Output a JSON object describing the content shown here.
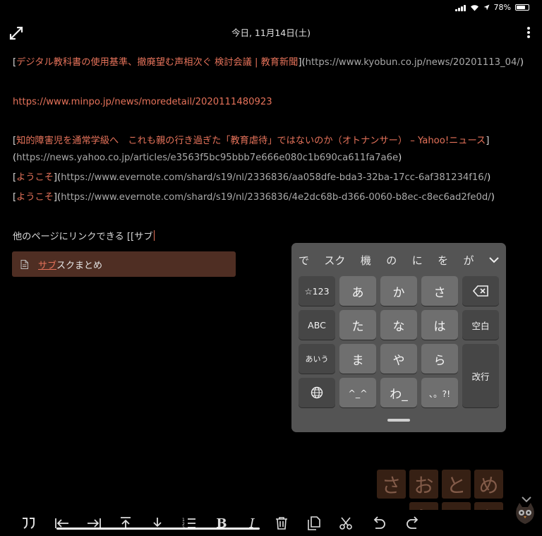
{
  "status_bar": {
    "battery": "78%",
    "battery_level": 0.78
  },
  "header": {
    "date": "今日, 11月14日(土)",
    "expand_icon": "expand-icon",
    "more_icon": "more-vertical-icon"
  },
  "note": {
    "l1": {
      "open": "[",
      "title": "デジタル教科書の使用基準、撤廃望む声相次ぐ 検討会議 | 教育新聞",
      "mid": "](",
      "url": "https://www.kyobun.co.jp/news/20201113_04/",
      "close": ")"
    },
    "l2": {
      "url": "https://www.minpo.jp/news/moredetail/2020111480923"
    },
    "l3": {
      "open": "[",
      "title": "知的障害児を通常学級へ　これも親の行き過ぎた「教育虐待」ではないのか（オトナンサー） – Yahoo!ニュース",
      "close": "]"
    },
    "l4": {
      "open": "(",
      "url": "https://news.yahoo.co.jp/articles/e3563f5bc95bbb7e666e080c1b690ca611fa7a6e",
      "close": ")"
    },
    "l5": {
      "open": "[",
      "title": "ようこそ",
      "mid": "](",
      "url": "https://www.evernote.com/shard/s19/nl/2336836/aa058dfe-bda3-32ba-17cc-6af381234f16/",
      "close": ")"
    },
    "l6": {
      "open": "[",
      "title": "ようこそ",
      "mid": "](",
      "url": "https://www.evernote.com/shard/s19/nl/2336836/4e2dc68b-d366-0060-b8ec-c8ec6ad2fe0d/",
      "close": ")"
    },
    "typing": "他のページにリンクできる [[サブ"
  },
  "suggestion": {
    "match": "サブ",
    "rest": "スクまとめ"
  },
  "keyboard": {
    "candidates": [
      "で",
      "スク",
      "機",
      "の",
      "に",
      "を",
      "が"
    ],
    "keys": {
      "sym": "☆123",
      "abc": "ABC",
      "kana": "あいう",
      "space": "空白",
      "ret": "改行",
      "a": "あ",
      "ka": "か",
      "sa": "さ",
      "ta": "た",
      "na": "な",
      "ha": "は",
      "ma": "ま",
      "ya": "や",
      "ra": "ら",
      "emo": "^_^",
      "wa": "わ_",
      "punct": "、。?!"
    }
  },
  "watermark": [
    "さ",
    "お",
    "と",
    "め",
    "ら",
    "い",
    "ふ"
  ],
  "toolbar": {
    "bold": "B",
    "italic": "I"
  }
}
